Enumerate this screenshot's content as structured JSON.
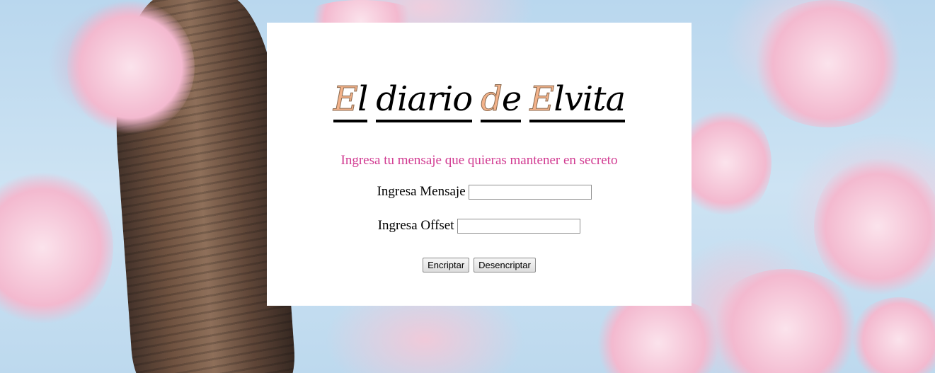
{
  "background": {
    "description_colors": {
      "sky": "#bdd9ee",
      "blossom": "#f3b9cf",
      "trunk": "#6a4a36"
    }
  },
  "logo": {
    "part1_initial": "E",
    "part1_rest": "l",
    "part2": "diario",
    "part3_initial": "d",
    "part3_rest": "e",
    "part4_initial": "E",
    "part4_rest": "lvita",
    "accent_color": "#f3b28a"
  },
  "form": {
    "subtitle": "Ingresa tu mensaje que quieras mantener en secreto",
    "message_label": "Ingresa Mensaje",
    "message_value": "",
    "offset_label": "Ingresa Offset",
    "offset_value": "",
    "subtitle_color": "#d13a91"
  },
  "buttons": {
    "encrypt": "Encriptar",
    "decrypt": "Desencriptar"
  }
}
